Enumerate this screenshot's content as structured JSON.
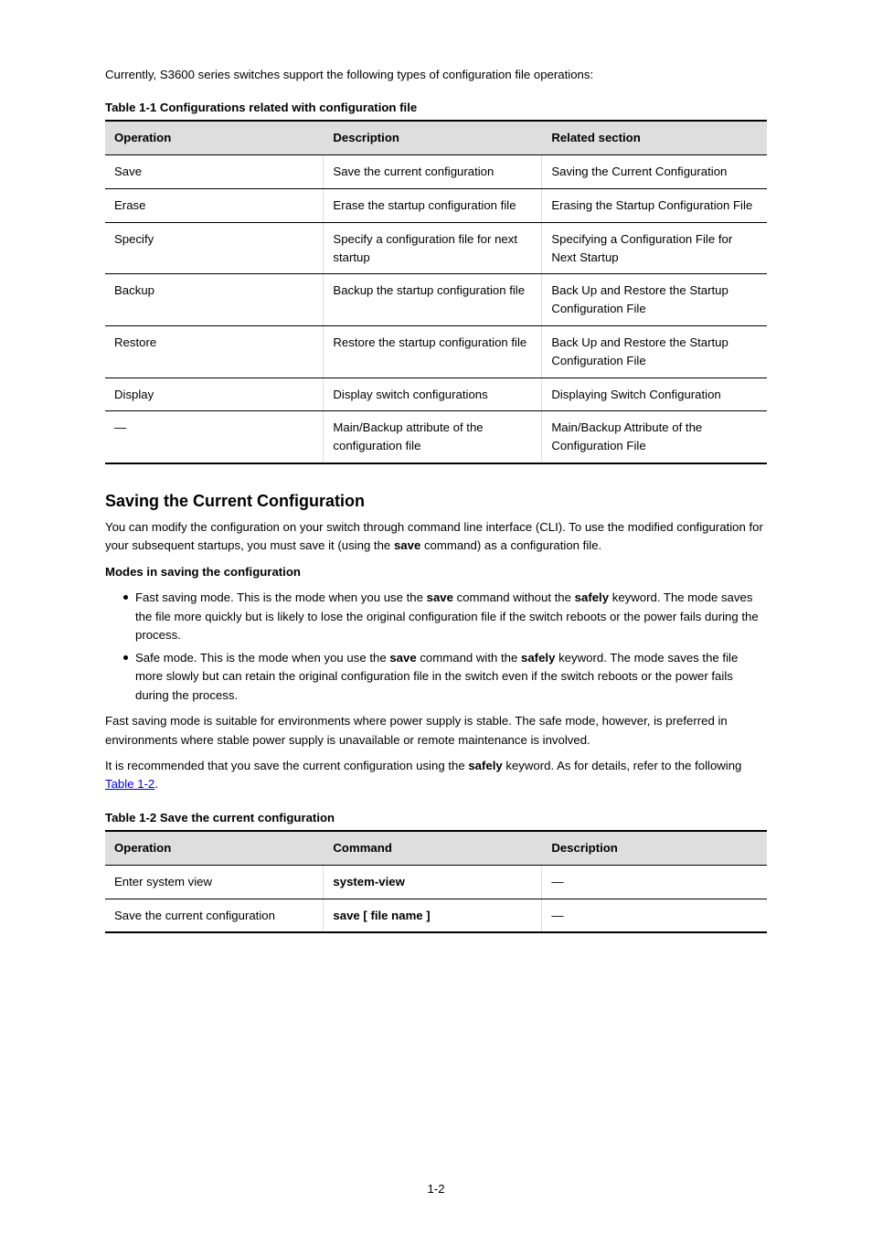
{
  "intro": "Currently, S3600 series switches support the following types of configuration file operations:",
  "table1": {
    "caption": "Table 1-1 Configurations related with configuration file",
    "head": [
      "Operation",
      "Description",
      "Related section"
    ],
    "rows": [
      [
        "Save",
        "Save the current configuration",
        "Saving the Current Configuration"
      ],
      [
        "Erase",
        "Erase the startup configuration file",
        "Erasing the Startup Configuration File"
      ],
      [
        "Specify",
        "Specify a configuration file for next startup",
        "Specifying a Configuration File for Next Startup"
      ],
      [
        "Backup",
        "Backup the startup configuration file",
        "Back Up and Restore the Startup Configuration File"
      ],
      [
        "Restore",
        "Restore the startup configuration file",
        "Back Up and Restore the Startup Configuration File"
      ],
      [
        "Display",
        "Display switch configurations",
        "Displaying Switch Configuration"
      ],
      [
        "—",
        "Main/Backup attribute of the configuration file",
        "Main/Backup Attribute of the Configuration File"
      ]
    ]
  },
  "section": {
    "title": "Saving the Current Configuration",
    "p1_a": "You can modify the configuration on your switch through command line interface (CLI). To use the modified configuration for your subsequent startups, you must save it (using the ",
    "p1_save": "save",
    "p1_b": " command) as a configuration file.",
    "h_modes_title": "Modes in saving the configuration",
    "bullets": [
      {
        "a": "Fast saving mode. This is the mode when you use the ",
        "save": "save",
        "b": " command without the ",
        "safely": "safely",
        "c": " keyword. The mode saves the file more quickly but is likely to lose the original configuration file if the switch reboots or the power fails during the process."
      },
      {
        "a": "Safe mode. This is the mode when you use the ",
        "save": "save",
        "b": " command with the ",
        "safely": "safely",
        "c": " keyword. The mode saves the file more slowly but can retain the original configuration file in the switch even if the switch reboots or the power fails during the process."
      }
    ],
    "p2": "Fast saving mode is suitable for environments where power supply is stable. The safe mode, however, is preferred in environments where stable power supply is unavailable or remote maintenance is involved.",
    "p3_a": "It is recommended that you save the current configuration using the ",
    "p3_b": " keyword. As for details, refer to the following ",
    "p3_table_link": "Table 1-2",
    "p3_c": "."
  },
  "table2": {
    "caption": "Table 1-2 Save the current configuration",
    "head": [
      "Operation",
      "Command",
      "Description"
    ],
    "rows": [
      [
        "Enter system view",
        "system-view",
        "—"
      ],
      [
        "Save the current configuration",
        "save [ file name ]",
        "—"
      ]
    ]
  },
  "page_number": "1-2"
}
